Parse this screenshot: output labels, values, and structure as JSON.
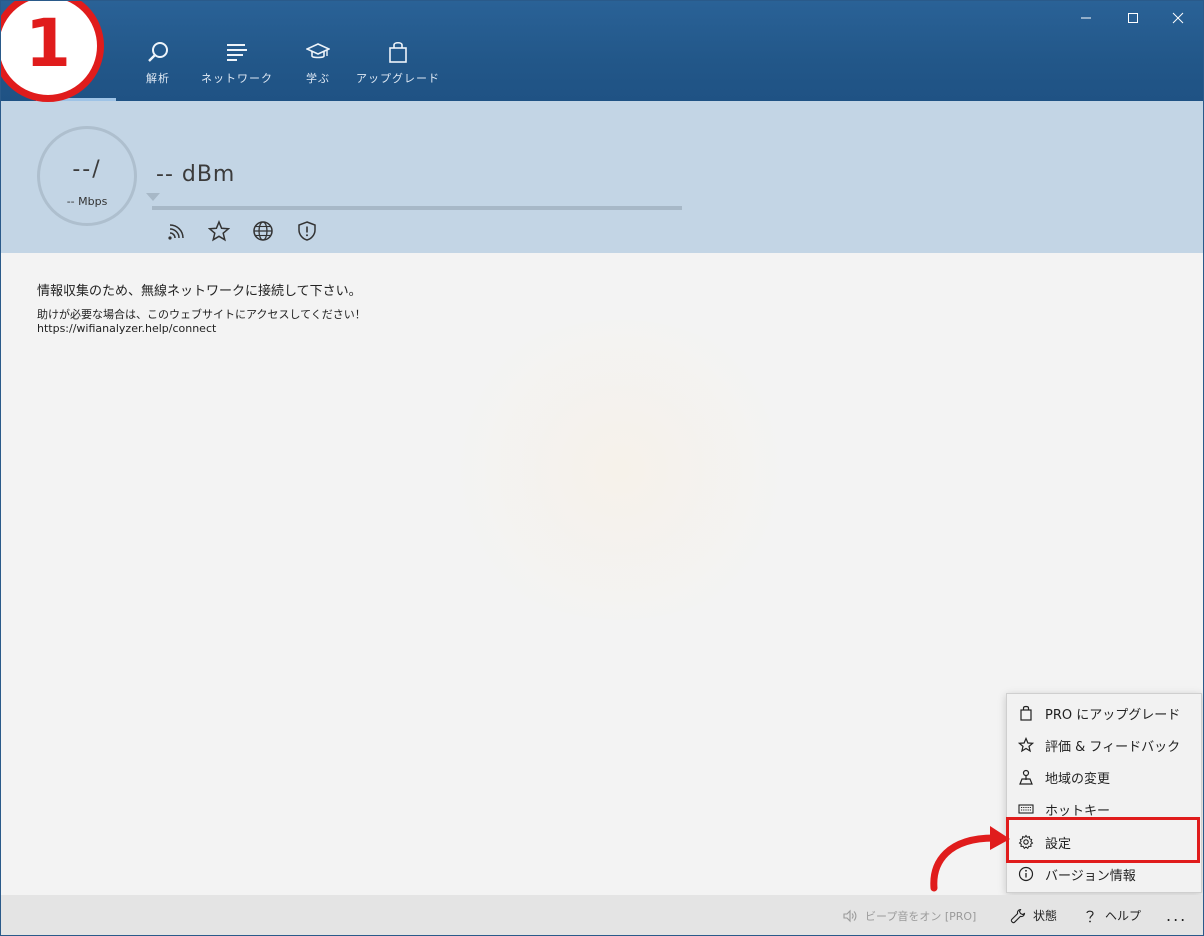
{
  "nav": {
    "badge": "1",
    "items": [
      {
        "label": "解析",
        "icon": "magnifier-icon"
      },
      {
        "label": "ネットワーク",
        "icon": "lines-icon"
      },
      {
        "label": "学ぶ",
        "icon": "graduation-cap-icon"
      },
      {
        "label": "アップグレード",
        "icon": "shopping-bag-icon"
      }
    ]
  },
  "status": {
    "speed": "--/",
    "speed_unit": "-- Mbps",
    "dbm": "-- dBm",
    "icons": [
      "wifi-signal-icon",
      "star-icon",
      "globe-icon",
      "shield-alert-icon"
    ]
  },
  "main": {
    "message": "情報収集のため、無線ネットワークに接続して下さい。",
    "help_text": "助けが必要な場合は、このウェブサイトにアクセスしてください！",
    "help_url": "https://wifianalyzer.help/connect"
  },
  "menu": {
    "items": [
      {
        "label": "PRO にアップグレード",
        "icon": "shopping-bag-icon"
      },
      {
        "label": "評価 & フィードバック",
        "icon": "star-icon"
      },
      {
        "label": "地域の変更",
        "icon": "map-pin-icon"
      },
      {
        "label": "ホットキー",
        "icon": "keyboard-icon"
      },
      {
        "label": "設定",
        "icon": "gear-icon"
      },
      {
        "label": "バージョン情報",
        "icon": "info-icon"
      }
    ],
    "highlighted": "設定"
  },
  "bottombar": {
    "beep": "ビープ音をオン [PRO]",
    "status": "状態",
    "help": "ヘルプ",
    "more": "..."
  },
  "colors": {
    "titlebar": "#225789",
    "band": "#c3d5e5",
    "highlight": "#e01c1c"
  }
}
